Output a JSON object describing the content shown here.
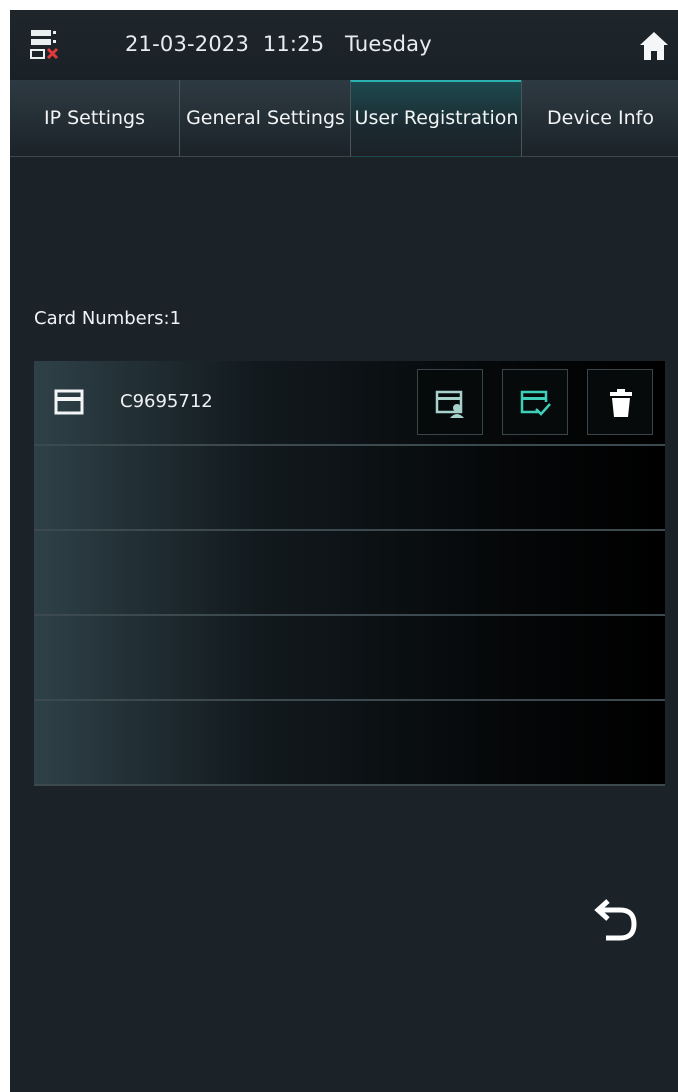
{
  "status_bar": {
    "network_icon": "network-disconnected-icon",
    "date": "21-03-2023",
    "time": "11:25",
    "weekday": "Tuesday",
    "home_icon": "home-icon"
  },
  "tabs": [
    {
      "label": "IP Settings",
      "active": false
    },
    {
      "label": "General Settings",
      "active": false
    },
    {
      "label": "User Registration",
      "active": true
    },
    {
      "label": "Device Info",
      "active": false
    }
  ],
  "card_list": {
    "count_label": "Card Numbers:1",
    "rows": [
      {
        "card_number": "C9695712",
        "actions": [
          "edit-user-card-icon",
          "confirm-card-icon",
          "trash-icon"
        ]
      },
      {
        "card_number": ""
      },
      {
        "card_number": ""
      },
      {
        "card_number": ""
      },
      {
        "card_number": ""
      }
    ]
  },
  "footer": {
    "back_icon": "back-arrow-icon"
  },
  "colors": {
    "background": "#1b2228",
    "accent": "#2bb3b1",
    "text": "#eef1f3",
    "error_red": "#e23a3a"
  }
}
